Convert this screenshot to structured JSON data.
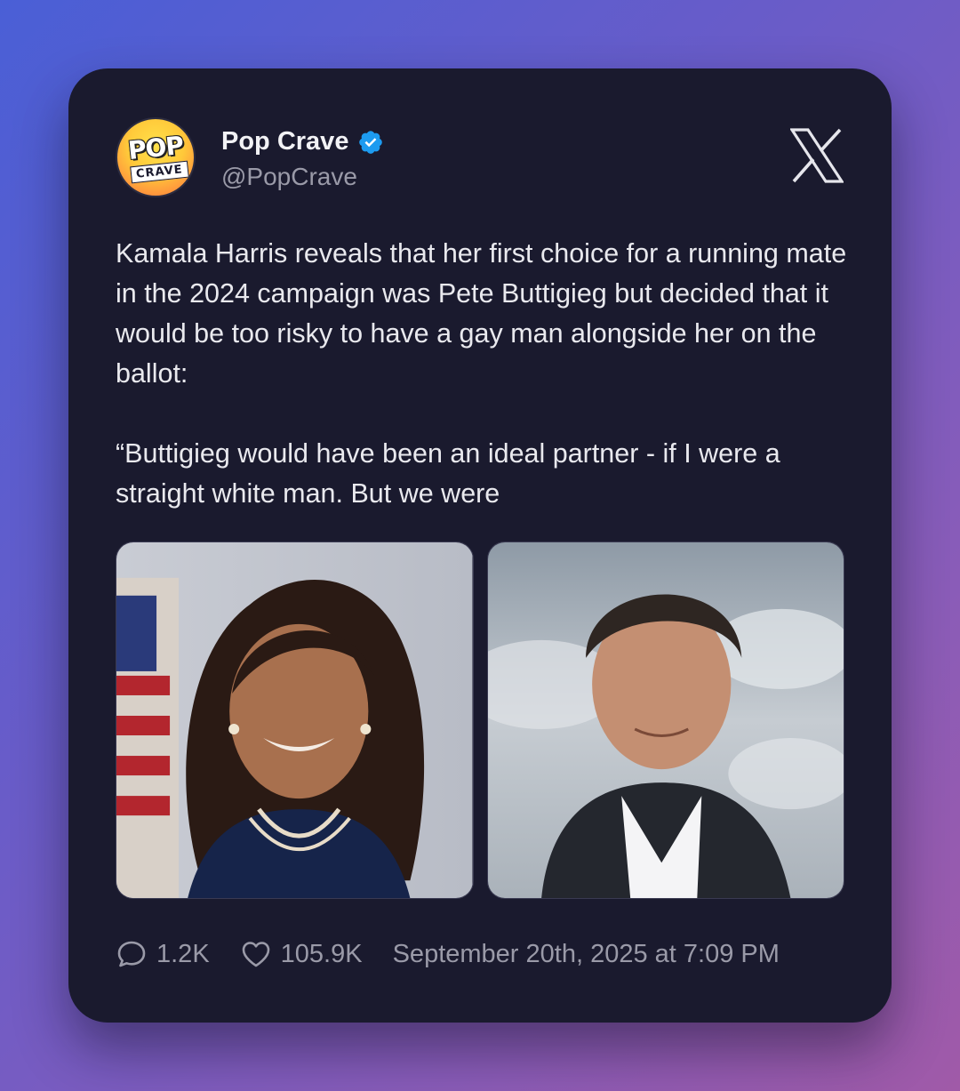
{
  "tweet": {
    "author": {
      "display_name": "Pop Crave",
      "handle": "@PopCrave",
      "verified": true,
      "avatar_text_top": "POP",
      "avatar_text_bottom": "CRAVE"
    },
    "platform_icon": "x-logo-icon",
    "text": "Kamala Harris reveals that her first choice for a running mate in the 2024 campaign was Pete Buttigieg but decided that it would be too risky to have a gay man alongside her on the ballot:\n\n“Buttigieg would have been an ideal partner - if I were a straight white man. But we were",
    "media": [
      {
        "icon": "portrait-photo-woman"
      },
      {
        "icon": "portrait-photo-man"
      }
    ],
    "stats": {
      "replies": "1.2K",
      "likes": "105.9K",
      "timestamp": "September 20th, 2025 at 7:09 PM"
    }
  },
  "colors": {
    "card_bg": "#1a1a2e",
    "verified": "#1d9bf0",
    "muted_text": "#9a9aa8",
    "body_text": "#e9e9ee"
  }
}
